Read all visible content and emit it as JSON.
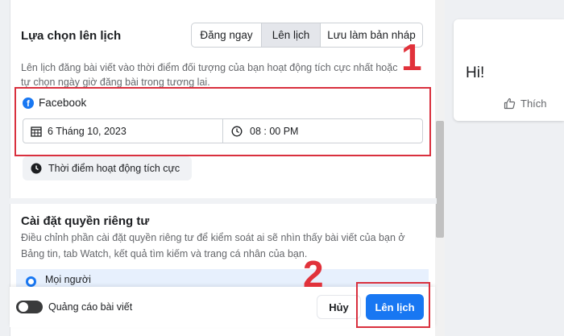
{
  "schedule": {
    "title": "Lựa chọn lên lịch",
    "tabs": [
      "Đăng ngay",
      "Lên lịch",
      "Lưu làm bản nháp"
    ],
    "description": "Lên lịch đăng bài viết vào thời điểm đối tượng của bạn hoạt động tích cực nhất hoặc tự chọn ngày giờ đăng bài trong tương lai.",
    "platform": "Facebook",
    "date": "6 Tháng 10, 2023",
    "time": "08 : 00 PM",
    "active_times_button": "Thời điểm hoạt động tích cực"
  },
  "privacy": {
    "title": "Cài đặt quyền riêng tư",
    "description": "Điều chỉnh phần cài đặt quyền riêng tư để kiểm soát ai sẽ nhìn thấy bài viết của bạn ở Bảng tin, tab Watch, kết quả tìm kiếm và trang cá nhân của bạn.",
    "option": "Mọi người"
  },
  "footer": {
    "ads_label": "Quảng cáo bài viết",
    "cancel_label": "Hủy",
    "schedule_label": "Lên lịch"
  },
  "preview": {
    "text": "Hi!",
    "like_label": "Thích"
  },
  "annotations": {
    "step1": "1",
    "step2": "2"
  },
  "colors": {
    "accent": "#1877f2",
    "highlight": "#d9303e"
  },
  "icons": [
    "facebook-icon",
    "calendar-icon",
    "clock-icon",
    "thumbs-up-icon"
  ]
}
